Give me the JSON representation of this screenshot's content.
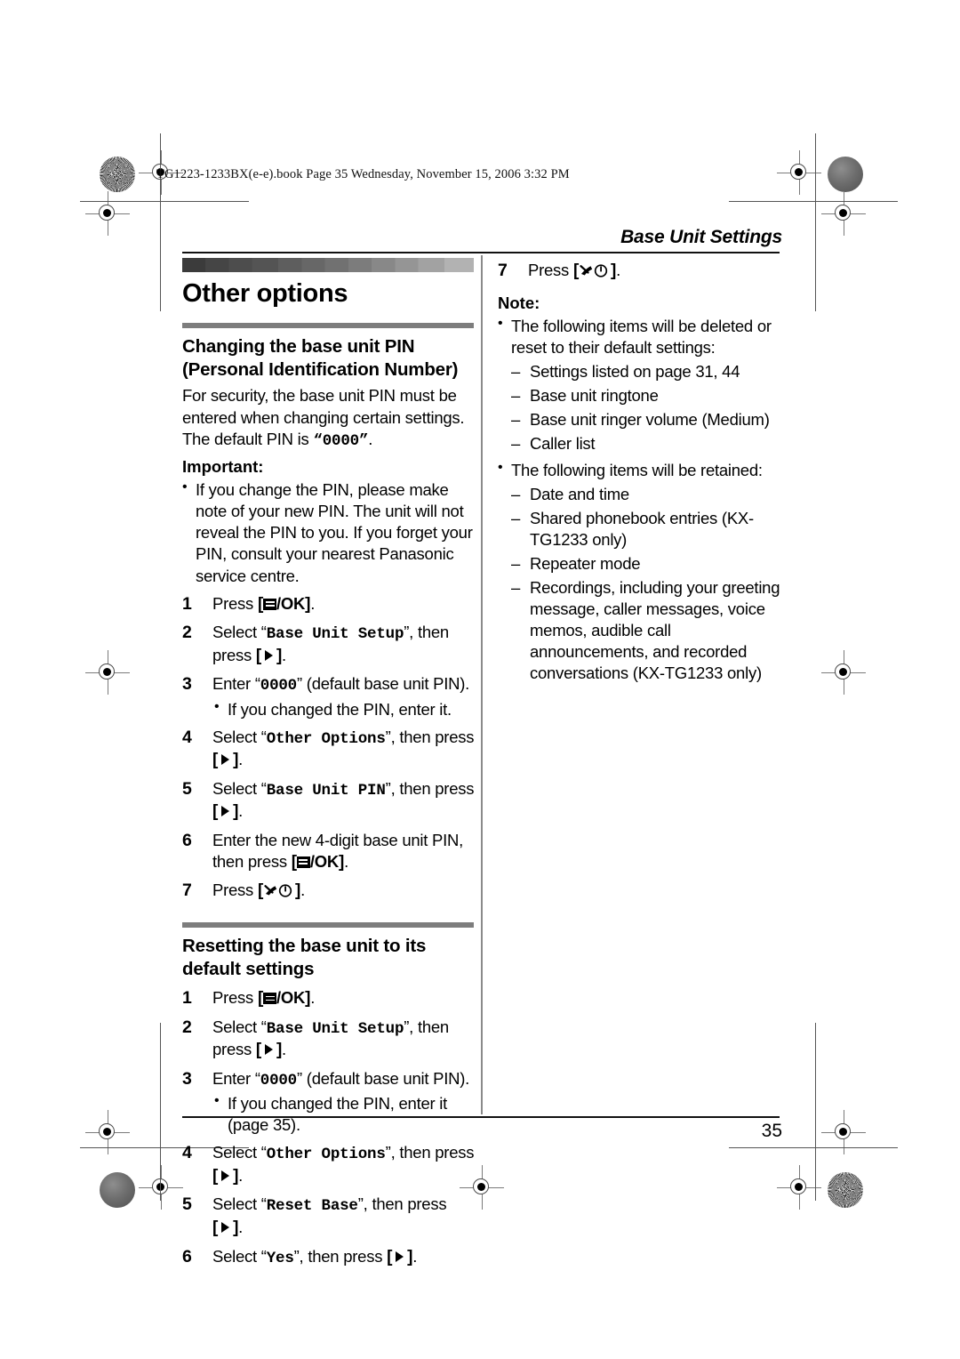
{
  "print_marks": {
    "book_line": "TG1223-1233BX(e-e).book  Page 35  Wednesday, November 15, 2006  3:32 PM"
  },
  "header": {
    "running_head": "Base Unit Settings"
  },
  "footer": {
    "page_number": "35"
  },
  "left_column": {
    "section_title": "Other options",
    "subsection_1": {
      "title_line_1": "Changing the base unit PIN",
      "title_line_2": "(Personal Identification Number)",
      "intro": "For security, the base unit PIN must be entered when changing certain settings. The default PIN is ",
      "intro_pin": "0000",
      "intro_tail": ".",
      "important_label": "Important:",
      "important_bullet": "If you change the PIN, please make note of your new PIN. The unit will not reveal the PIN to you. If you forget your PIN, consult your nearest Panasonic service centre.",
      "steps": [
        {
          "num": "1",
          "pre": "Press ",
          "key": "menu-ok",
          "post": "."
        },
        {
          "num": "2",
          "pre": "Select “",
          "mono": "Base Unit Setup",
          "mid": "”, then press ",
          "key": "right-arrow",
          "post": "."
        },
        {
          "num": "3",
          "pre": "Enter “",
          "mono": "0000",
          "mid": "” (default base unit PIN).",
          "sub_bullet": "If you changed the PIN, enter it."
        },
        {
          "num": "4",
          "pre": "Select “",
          "mono": "Other Options",
          "mid": "”, then press ",
          "key": "right-arrow",
          "post": "."
        },
        {
          "num": "5",
          "pre": "Select “",
          "mono": "Base Unit PIN",
          "mid": "”, then press ",
          "key": "right-arrow",
          "post": "."
        },
        {
          "num": "6",
          "pre": "Enter the new 4-digit base unit PIN, then press ",
          "key": "menu-ok",
          "post": "."
        },
        {
          "num": "7",
          "pre": "Press ",
          "key": "off-power",
          "post": "."
        }
      ]
    },
    "subsection_2": {
      "title_line_1": "Resetting the base unit to its",
      "title_line_2": "default settings",
      "steps": [
        {
          "num": "1",
          "pre": "Press ",
          "key": "menu-ok",
          "post": "."
        },
        {
          "num": "2",
          "pre": "Select “",
          "mono": "Base Unit Setup",
          "mid": "”, then press ",
          "key": "right-arrow",
          "post": "."
        },
        {
          "num": "3",
          "pre": "Enter “",
          "mono": "0000",
          "mid": "” (default base unit PIN).",
          "sub_bullet": "If you changed the PIN, enter it (page 35)."
        },
        {
          "num": "4",
          "pre": "Select “",
          "mono": "Other Options",
          "mid": "”, then press ",
          "key": "right-arrow",
          "post": "."
        },
        {
          "num": "5",
          "pre": "Select “",
          "mono": "Reset Base",
          "mid": "”, then press ",
          "key": "right-arrow",
          "post": "."
        },
        {
          "num": "6",
          "pre": "Select “",
          "mono": "Yes",
          "mid": "”, then press ",
          "key": "right-arrow",
          "post": "."
        }
      ]
    }
  },
  "right_column": {
    "step_7": {
      "num": "7",
      "pre": "Press ",
      "key": "off-power",
      "post": "."
    },
    "note_label": "Note:",
    "note_bullets": [
      {
        "text": "The following items will be deleted or reset to their default settings:",
        "items": [
          "Settings listed on page 31, 44",
          "Base unit ringtone",
          "Base unit ringer volume (Medium)",
          "Caller list"
        ]
      },
      {
        "text": "The following items will be retained:",
        "items": [
          "Date and time",
          "Shared phonebook entries (KX-TG1233 only)",
          "Repeater mode",
          "Recordings, including your greeting message, caller messages, voice memos, audible call announcements, and recorded conversations (KX-TG1233 only)"
        ]
      }
    ]
  }
}
